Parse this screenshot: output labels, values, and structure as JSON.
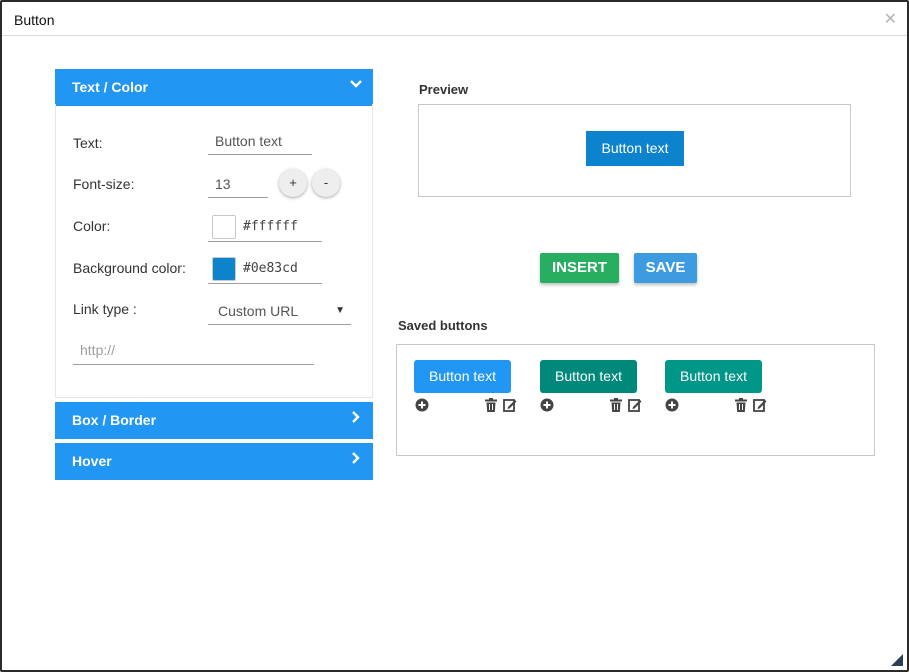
{
  "dialog": {
    "title": "Button",
    "close_glyph": "✕"
  },
  "accordion": {
    "sections": [
      {
        "label": "Text / Color",
        "state": "expanded"
      },
      {
        "label": "Box / Border",
        "state": "collapsed"
      },
      {
        "label": "Hover",
        "state": "collapsed"
      }
    ]
  },
  "form": {
    "text_label": "Text:",
    "text_value": "Button text",
    "font_size_label": "Font-size:",
    "font_size_value": "13",
    "increase_label": "+",
    "decrease_label": "-",
    "color_label": "Color:",
    "color_value": "#ffffff",
    "bg_color_label": "Background color:",
    "bg_color_value": "#0e83cd",
    "link_type_label": "Link type :",
    "link_type_value": "Custom URL",
    "url_placeholder": "http://"
  },
  "preview": {
    "label": "Preview",
    "button_text": "Button text"
  },
  "actions": {
    "insert_label": "INSERT",
    "save_label": "SAVE"
  },
  "saved": {
    "label": "Saved buttons",
    "items": [
      {
        "text": "Button text",
        "bg": "#2196f3"
      },
      {
        "text": "Button text",
        "bg": "#00897b"
      },
      {
        "text": "Button text",
        "bg": "#009688"
      }
    ]
  },
  "colors": {
    "accent": "#2196f3",
    "insert": "#27ae60",
    "save": "#3d9be0",
    "preview_bg": "#0e83cd"
  }
}
